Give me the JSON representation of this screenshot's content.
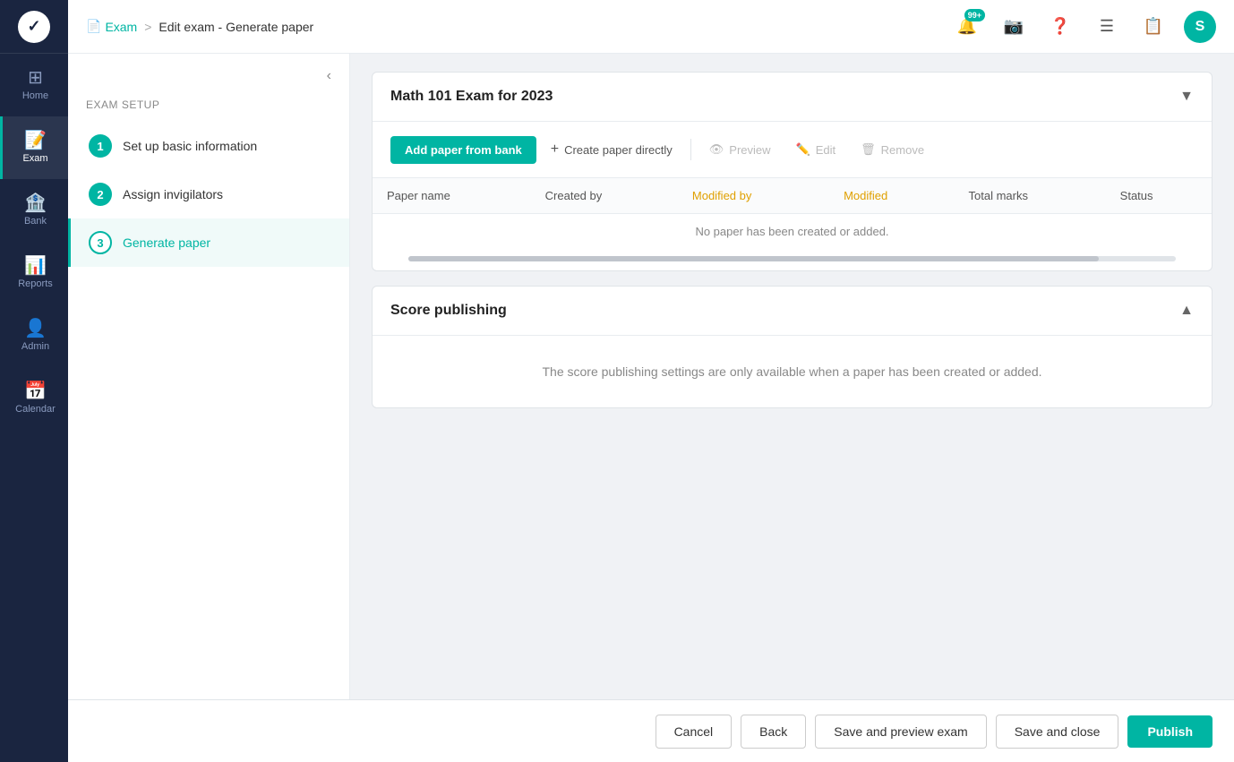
{
  "app": {
    "logo_letter": "✓",
    "title": "Edit exam - Generate paper"
  },
  "breadcrumb": {
    "icon": "📄",
    "link_label": "Exam",
    "separator": ">",
    "current": "Edit exam - Generate paper"
  },
  "topbar": {
    "notification_icon": "🔔",
    "notification_badge": "99+",
    "camera_icon": "📷",
    "help_icon": "❓",
    "list_icon": "☰",
    "doc_icon": "📋",
    "avatar_letter": "S"
  },
  "sidebar": {
    "items": [
      {
        "id": "home",
        "label": "Home",
        "icon": "⊞",
        "active": false
      },
      {
        "id": "exam",
        "label": "Exam",
        "icon": "📝",
        "active": true
      },
      {
        "id": "bank",
        "label": "Bank",
        "icon": "🏦",
        "active": false
      },
      {
        "id": "reports",
        "label": "Reports",
        "icon": "📊",
        "active": false
      },
      {
        "id": "admin",
        "label": "Admin",
        "icon": "👤",
        "active": false
      },
      {
        "id": "calendar",
        "label": "Calendar",
        "icon": "📅",
        "active": false
      }
    ]
  },
  "left_panel": {
    "collapse_arrow": "‹",
    "setup_label": "Exam setup",
    "steps": [
      {
        "number": "1",
        "label": "Set up basic information",
        "state": "done"
      },
      {
        "number": "2",
        "label": "Assign invigilators",
        "state": "done"
      },
      {
        "number": "3",
        "label": "Generate paper",
        "state": "current"
      }
    ]
  },
  "paper_section": {
    "title": "Math 101 Exam for 2023",
    "toggle_icon": "▼",
    "toolbar": {
      "add_paper_label": "Add paper from bank",
      "create_direct_label": "Create paper directly",
      "preview_label": "Preview",
      "edit_label": "Edit",
      "remove_label": "Remove"
    },
    "table": {
      "columns": [
        {
          "id": "paper_name",
          "label": "Paper name",
          "sort": false
        },
        {
          "id": "created_by",
          "label": "Created by",
          "sort": false
        },
        {
          "id": "modified_by",
          "label": "Modified by",
          "sort": true
        },
        {
          "id": "modified",
          "label": "Modified",
          "sort": true
        },
        {
          "id": "total_marks",
          "label": "Total marks",
          "sort": false
        },
        {
          "id": "status",
          "label": "Status",
          "sort": false
        }
      ],
      "empty_message": "No paper has been created or added."
    }
  },
  "score_publishing": {
    "title": "Score publishing",
    "toggle_icon": "▲",
    "empty_message": "The score publishing settings are only available when a paper has been created or added."
  },
  "bottom_bar": {
    "cancel_label": "Cancel",
    "back_label": "Back",
    "save_preview_label": "Save and preview exam",
    "save_close_label": "Save and close",
    "publish_label": "Publish"
  }
}
